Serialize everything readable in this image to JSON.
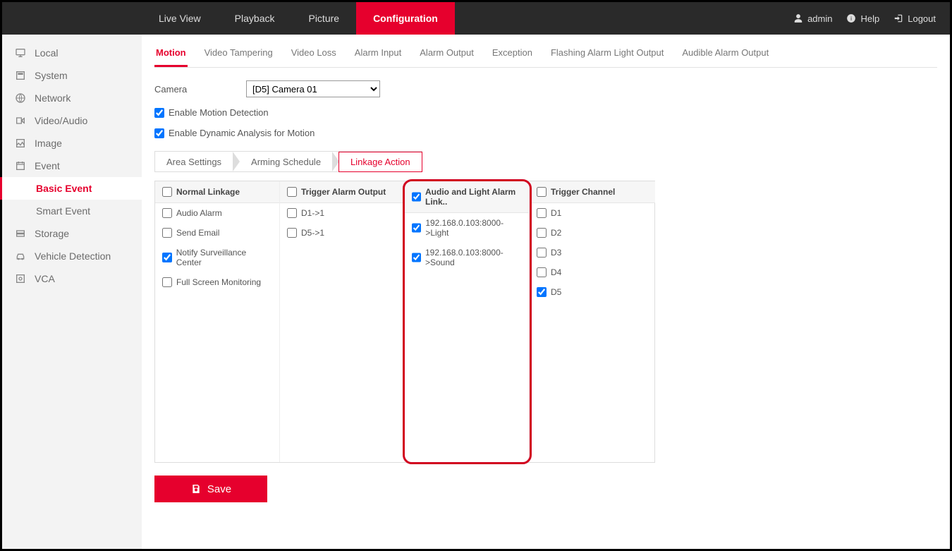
{
  "topnav": {
    "items": [
      "Live View",
      "Playback",
      "Picture",
      "Configuration"
    ],
    "active_index": 3
  },
  "topright": {
    "user": "admin",
    "help": "Help",
    "logout": "Logout"
  },
  "sidebar": {
    "items": [
      {
        "label": "Local"
      },
      {
        "label": "System"
      },
      {
        "label": "Network"
      },
      {
        "label": "Video/Audio"
      },
      {
        "label": "Image"
      },
      {
        "label": "Event",
        "children": [
          {
            "label": "Basic Event",
            "active": true
          },
          {
            "label": "Smart Event"
          }
        ]
      },
      {
        "label": "Storage"
      },
      {
        "label": "Vehicle Detection"
      },
      {
        "label": "VCA"
      }
    ]
  },
  "subtabs": {
    "items": [
      "Motion",
      "Video Tampering",
      "Video Loss",
      "Alarm Input",
      "Alarm Output",
      "Exception",
      "Flashing Alarm Light Output",
      "Audible Alarm Output"
    ],
    "active_index": 0
  },
  "form": {
    "camera_label": "Camera",
    "camera_value": "[D5] Camera 01",
    "enable_motion": {
      "label": "Enable Motion Detection",
      "checked": true
    },
    "enable_dynamic": {
      "label": "Enable Dynamic Analysis for Motion",
      "checked": true
    }
  },
  "steps": {
    "items": [
      "Area Settings",
      "Arming Schedule",
      "Linkage Action"
    ],
    "active_index": 2
  },
  "linkage": {
    "columns": [
      {
        "header": "Normal Linkage",
        "header_checked": false,
        "rows": [
          {
            "label": "Audio Alarm",
            "checked": false
          },
          {
            "label": "Send Email",
            "checked": false
          },
          {
            "label": "Notify Surveillance Center",
            "checked": true
          },
          {
            "label": "Full Screen Monitoring",
            "checked": false
          }
        ]
      },
      {
        "header": "Trigger Alarm Output",
        "header_checked": false,
        "rows": [
          {
            "label": "D1->1",
            "checked": false
          },
          {
            "label": "D5->1",
            "checked": false
          }
        ]
      },
      {
        "header": "Audio and Light Alarm Link..",
        "header_checked": true,
        "highlight": true,
        "rows": [
          {
            "label": "192.168.0.103:8000->Light",
            "checked": true
          },
          {
            "label": "192.168.0.103:8000->Sound",
            "checked": true
          }
        ]
      },
      {
        "header": "Trigger Channel",
        "header_checked": false,
        "rows": [
          {
            "label": "D1",
            "checked": false
          },
          {
            "label": "D2",
            "checked": false
          },
          {
            "label": "D3",
            "checked": false
          },
          {
            "label": "D4",
            "checked": false
          },
          {
            "label": "D5",
            "checked": true
          }
        ]
      }
    ]
  },
  "save_label": "Save"
}
